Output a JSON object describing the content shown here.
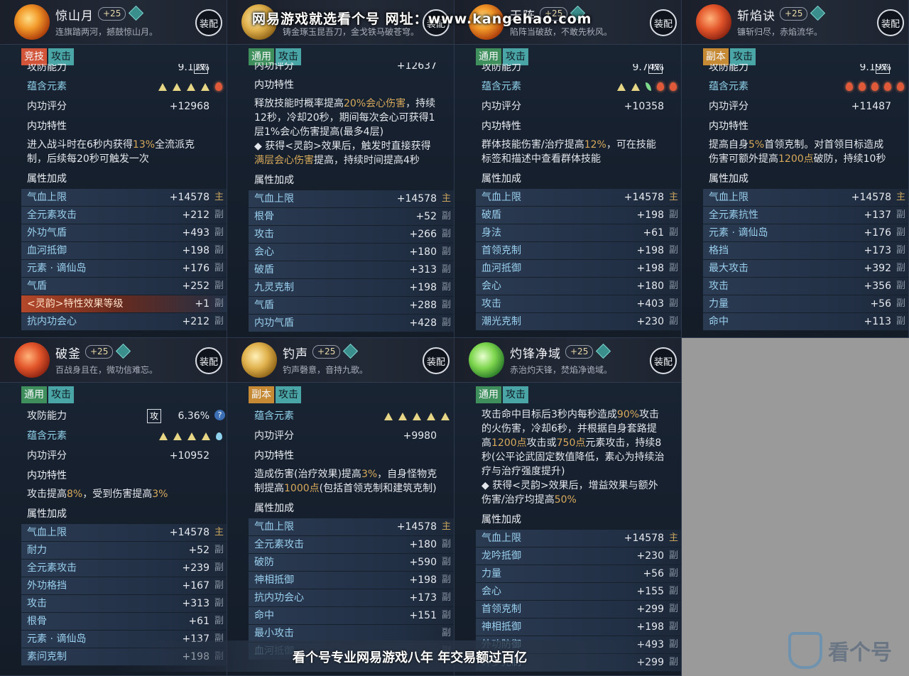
{
  "watermark": {
    "top_text": "网易游戏就选看个号   网址：www.kangehao.com",
    "bottom_text": "看个号专业网易游戏八年 年交易额过百亿",
    "brand_text": "看个号"
  },
  "equip_label": "装配",
  "cards": [
    {
      "id": "jingshanyue",
      "name": "惊山月",
      "level": "+25",
      "desc": "连旗踏两河，撼鼓惊山月。",
      "icon": "fire",
      "tags": [
        {
          "text": "竞技",
          "style": "t-red"
        },
        {
          "text": "攻击",
          "style": "t-teal"
        }
      ],
      "top_partial": {
        "label": "攻防能力",
        "gong": "攻",
        "value": "9.11%"
      },
      "element_label": "蕴含元素",
      "elements": [
        "tri",
        "tri",
        "tri",
        "tri",
        "flame"
      ],
      "score_label": "内功评分",
      "score": "+12968",
      "trait_label": "内功特性",
      "trait_parts": [
        {
          "t": "进入战斗时在6秒内获得"
        },
        {
          "t": "13%",
          "h": true
        },
        {
          "t": "全流派克制，后续每20秒可触发一次"
        }
      ],
      "attr_label": "属性加成",
      "stats": [
        {
          "label": "气血上限",
          "value": "+14578",
          "mark": "主",
          "main": true
        },
        {
          "label": "全元素攻击",
          "value": "+212",
          "mark": "副"
        },
        {
          "label": "外功气盾",
          "value": "+493",
          "mark": "副"
        },
        {
          "label": "血河抵御",
          "value": "+198",
          "mark": "副"
        },
        {
          "label": "元素 · 谪仙岛",
          "value": "+176",
          "mark": "副"
        },
        {
          "label": "气盾",
          "value": "+252",
          "mark": "副"
        },
        {
          "label": "<灵韵>特性效果等级",
          "value": "+1",
          "mark": "副",
          "special": true
        },
        {
          "label": "抗内功会心",
          "value": "+212",
          "mark": "副"
        }
      ]
    },
    {
      "id": "card2",
      "name": "",
      "level": "",
      "desc": "铸金琢玉昆吾刀，金戈铁马破苍穹。",
      "icon": "gold",
      "tags": [
        {
          "text": "通用",
          "style": "t-green"
        },
        {
          "text": "攻击",
          "style": "t-teal"
        }
      ],
      "top_partial": {
        "label": "内功评分",
        "gong": "",
        "value": "+12637"
      },
      "trait_label": "内功特性",
      "trait_parts": [
        {
          "t": "释放技能时概率提高"
        },
        {
          "t": "20%会心伤害",
          "h": true
        },
        {
          "t": "，持续12秒，冷却20秒，期间每次会心可获得1层1%会心伤害提高(最多4层)"
        },
        {
          "t": "\n◆ 获得<灵韵>效果后，触发时直接获得"
        },
        {
          "t": "满层会心伤害",
          "h": true
        },
        {
          "t": "提高，持续时间提高4秒"
        }
      ],
      "attr_label": "属性加成",
      "stats": [
        {
          "label": "气血上限",
          "value": "+14578",
          "mark": "主",
          "main": true
        },
        {
          "label": "根骨",
          "value": "+52",
          "mark": "副"
        },
        {
          "label": "攻击",
          "value": "+266",
          "mark": "副"
        },
        {
          "label": "会心",
          "value": "+180",
          "mark": "副"
        },
        {
          "label": "破盾",
          "value": "+313",
          "mark": "副"
        },
        {
          "label": "九灵克制",
          "value": "+198",
          "mark": "副"
        },
        {
          "label": "气盾",
          "value": "+288",
          "mark": "副"
        },
        {
          "label": "内功气盾",
          "value": "+428",
          "mark": "副"
        }
      ]
    },
    {
      "id": "tianzhen",
      "name": "天阵",
      "level": "+25",
      "desc": "陷阵当破敌，不敢先秋风。",
      "icon": "fire",
      "tags": [
        {
          "text": "通用",
          "style": "t-green"
        },
        {
          "text": "攻击",
          "style": "t-teal"
        }
      ],
      "top_partial": {
        "label": "攻防能力",
        "gong": "攻",
        "value": "9.74%"
      },
      "element_label": "蕴含元素",
      "elements": [
        "tri",
        "tri",
        "leaf",
        "flame",
        "flame"
      ],
      "score_label": "内功评分",
      "score": "+10358",
      "trait_label": "内功特性",
      "trait_parts": [
        {
          "t": "群体技能伤害/治疗提高"
        },
        {
          "t": "12%",
          "h": true
        },
        {
          "t": "，可在技能标签和描述中查看群体技能"
        }
      ],
      "attr_label": "属性加成",
      "stats": [
        {
          "label": "气血上限",
          "value": "+14578",
          "mark": "主",
          "main": true
        },
        {
          "label": "破盾",
          "value": "+198",
          "mark": "副"
        },
        {
          "label": "身法",
          "value": "+61",
          "mark": "副"
        },
        {
          "label": "首领克制",
          "value": "+198",
          "mark": "副"
        },
        {
          "label": "血河抵御",
          "value": "+198",
          "mark": "副"
        },
        {
          "label": "会心",
          "value": "+180",
          "mark": "副"
        },
        {
          "label": "攻击",
          "value": "+403",
          "mark": "副"
        },
        {
          "label": "潮光克制",
          "value": "+230",
          "mark": "副"
        }
      ]
    },
    {
      "id": "zhanyanjue",
      "name": "斩焰诀",
      "level": "+25",
      "desc": "镰斩归尽，赤焰流华。",
      "icon": "red",
      "tags": [
        {
          "text": "副本",
          "style": "t-orange"
        },
        {
          "text": "攻击",
          "style": "t-teal"
        }
      ],
      "top_partial": {
        "label": "攻防能力",
        "gong": "攻",
        "value": "9.19%"
      },
      "element_label": "蕴含元素",
      "elements": [
        "flame",
        "flame",
        "flame",
        "flame",
        "flame"
      ],
      "score_label": "内功评分",
      "score": "+11487",
      "trait_label": "内功特性",
      "trait_parts": [
        {
          "t": "提高自身"
        },
        {
          "t": "5%",
          "h": true
        },
        {
          "t": "首领克制。对首领目标造成伤害可额外提高"
        },
        {
          "t": "1200点",
          "h": true
        },
        {
          "t": "破防，持续10秒"
        }
      ],
      "attr_label": "属性加成",
      "stats": [
        {
          "label": "气血上限",
          "value": "+14578",
          "mark": "主",
          "main": true
        },
        {
          "label": "全元素抗性",
          "value": "+137",
          "mark": "副"
        },
        {
          "label": "元素 · 谪仙岛",
          "value": "+176",
          "mark": "副"
        },
        {
          "label": "格挡",
          "value": "+173",
          "mark": "副"
        },
        {
          "label": "最大攻击",
          "value": "+392",
          "mark": "副"
        },
        {
          "label": "攻击",
          "value": "+356",
          "mark": "副"
        },
        {
          "label": "力量",
          "value": "+56",
          "mark": "副"
        },
        {
          "label": "命中",
          "value": "+113",
          "mark": "副"
        }
      ]
    },
    {
      "id": "pofu",
      "name": "破釜",
      "level": "+25",
      "desc": "百战身且在，微功信难忘。",
      "icon": "red",
      "tags": [
        {
          "text": "通用",
          "style": "t-green"
        },
        {
          "text": "攻击",
          "style": "t-teal"
        }
      ],
      "gongfang": {
        "label": "攻防能力",
        "gong": "攻",
        "value": "6.36%"
      },
      "element_label": "蕴含元素",
      "elements": [
        "tri",
        "tri",
        "tri",
        "tri",
        "drop"
      ],
      "score_label": "内功评分",
      "score": "+10952",
      "trait_label": "内功特性",
      "trait_parts": [
        {
          "t": "攻击提高"
        },
        {
          "t": "8%",
          "h": true
        },
        {
          "t": "，受到伤害提高"
        },
        {
          "t": "3%",
          "h": true
        }
      ],
      "attr_label": "属性加成",
      "stats": [
        {
          "label": "气血上限",
          "value": "+14578",
          "mark": "主",
          "main": true
        },
        {
          "label": "耐力",
          "value": "+52",
          "mark": "副"
        },
        {
          "label": "全元素攻击",
          "value": "+239",
          "mark": "副"
        },
        {
          "label": "外功格挡",
          "value": "+167",
          "mark": "副"
        },
        {
          "label": "攻击",
          "value": "+313",
          "mark": "副"
        },
        {
          "label": "根骨",
          "value": "+61",
          "mark": "副"
        },
        {
          "label": "元素 · 谪仙岛",
          "value": "+137",
          "mark": "副"
        },
        {
          "label": "素问克制",
          "value": "+198",
          "mark": "副"
        }
      ]
    },
    {
      "id": "diaosheng",
      "name": "钓声",
      "level": "+25",
      "desc": "钓声磬意，音持九歌。",
      "icon": "gold",
      "tags": [
        {
          "text": "副本",
          "style": "t-orange"
        },
        {
          "text": "攻击",
          "style": "t-teal"
        }
      ],
      "element_label": "蕴含元素",
      "elements": [
        "tri",
        "tri",
        "tri",
        "tri",
        "tri"
      ],
      "score_label": "内功评分",
      "score": "+9980",
      "trait_label": "内功特性",
      "trait_parts": [
        {
          "t": "造成伤害(治疗效果)提高"
        },
        {
          "t": "3%",
          "h": true
        },
        {
          "t": "，自身怪物克制提高"
        },
        {
          "t": "1000点",
          "h": true
        },
        {
          "t": "(包括首领克制和建筑克制)"
        }
      ],
      "attr_label": "属性加成",
      "stats": [
        {
          "label": "气血上限",
          "value": "+14578",
          "mark": "主",
          "main": true
        },
        {
          "label": "全元素攻击",
          "value": "+180",
          "mark": "副"
        },
        {
          "label": "破防",
          "value": "+590",
          "mark": "副"
        },
        {
          "label": "神相抵御",
          "value": "+198",
          "mark": "副"
        },
        {
          "label": "抗内功会心",
          "value": "+173",
          "mark": "副"
        },
        {
          "label": "命中",
          "value": "+151",
          "mark": "副"
        },
        {
          "label": "最小攻击",
          "value": "",
          "mark": "副"
        },
        {
          "label": "血河抵御",
          "value": "",
          "mark": "副"
        }
      ]
    },
    {
      "id": "zhuofeng",
      "name": "灼锋净域",
      "level": "+25",
      "desc": "赤治灼天锋，焚焰净诡域。",
      "icon": "green",
      "tags": [
        {
          "text": "通用",
          "style": "t-green"
        },
        {
          "text": "攻击",
          "style": "t-teal"
        }
      ],
      "trait_parts": [
        {
          "t": "攻击命中目标后3秒内每秒造成"
        },
        {
          "t": "90%",
          "h": true
        },
        {
          "t": "攻击的火伤害，冷却6秒，并根据自身套路提高"
        },
        {
          "t": "1200点",
          "h": true
        },
        {
          "t": "攻击或"
        },
        {
          "t": "750点",
          "h": true
        },
        {
          "t": "元素攻击，持续8秒(公平论武固定数值降低，素心为持续治疗与治疗强度提升)"
        },
        {
          "t": "\n◆ 获得<灵韵>效果后，增益效果与额外伤害/治疗均提高"
        },
        {
          "t": "50%",
          "h": true
        }
      ],
      "attr_label": "属性加成",
      "stats": [
        {
          "label": "气血上限",
          "value": "+14578",
          "mark": "主",
          "main": true
        },
        {
          "label": "龙吟抵御",
          "value": "+230",
          "mark": "副"
        },
        {
          "label": "力量",
          "value": "+56",
          "mark": "副"
        },
        {
          "label": "会心",
          "value": "+155",
          "mark": "副"
        },
        {
          "label": "首领克制",
          "value": "+299",
          "mark": "副"
        },
        {
          "label": "神相抵御",
          "value": "+198",
          "mark": "副"
        },
        {
          "label": "外功防御",
          "value": "+493",
          "mark": "副"
        },
        {
          "label": "碎梦克制",
          "value": "+299",
          "mark": "副"
        }
      ]
    }
  ]
}
